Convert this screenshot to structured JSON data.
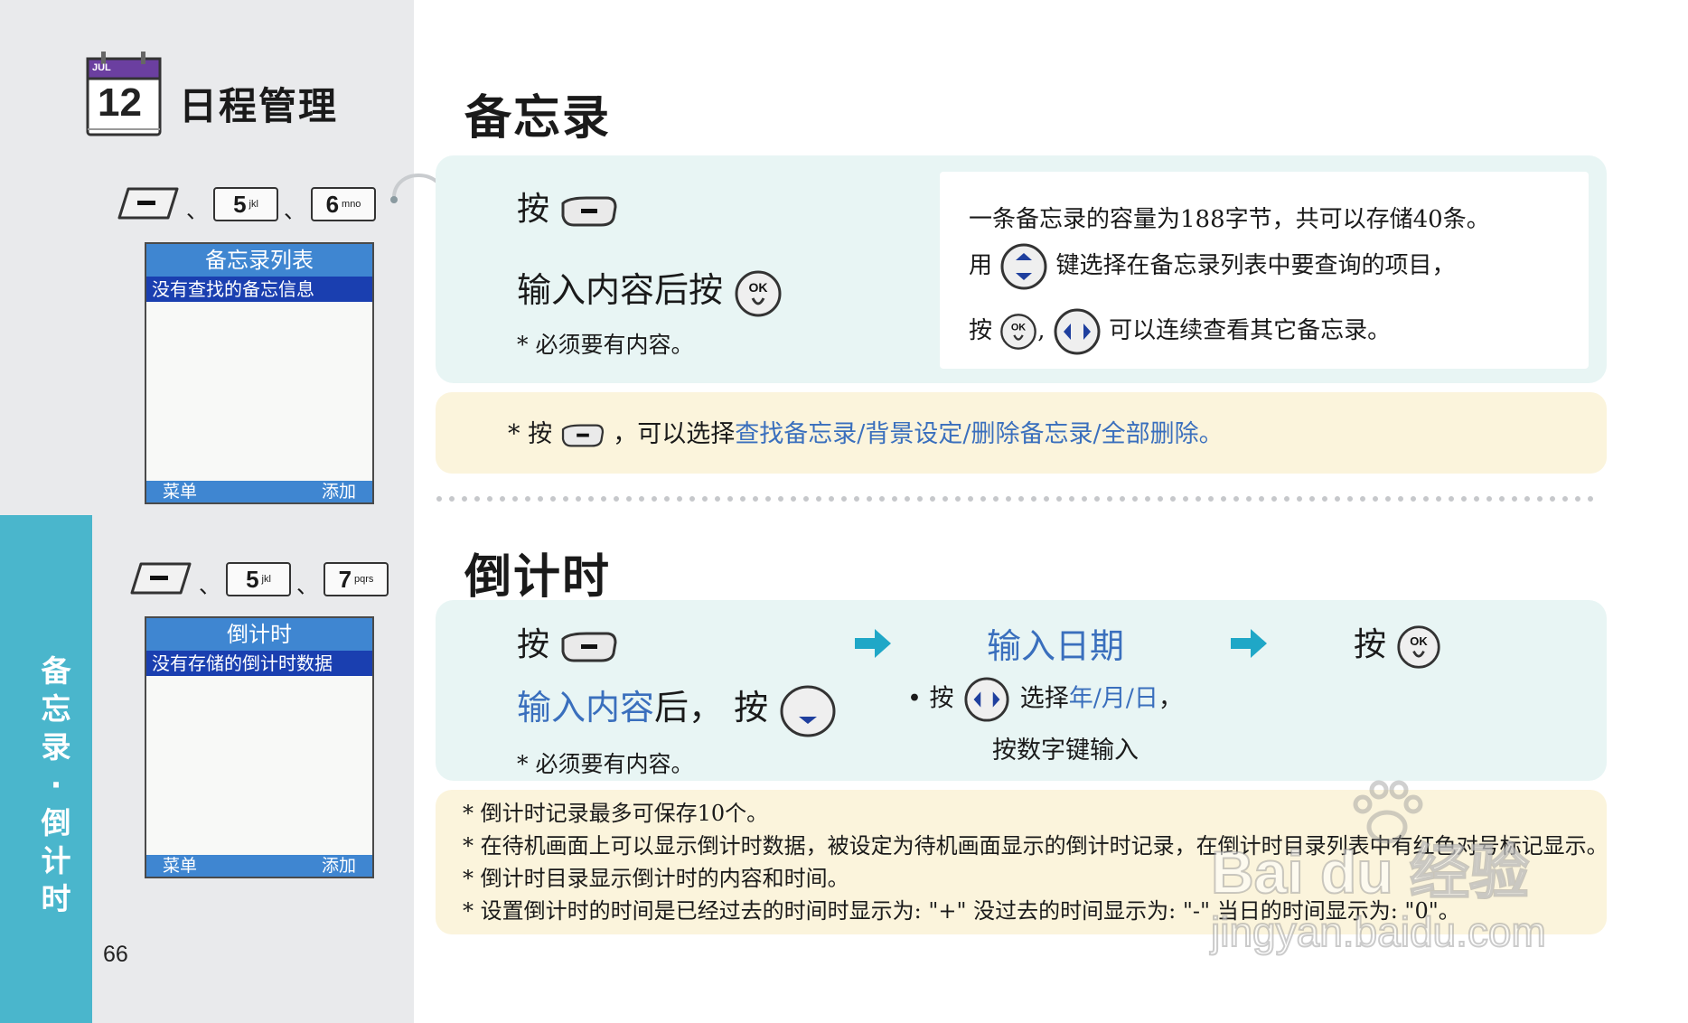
{
  "chapter": {
    "calendar_month": "JUL",
    "calendar_day": "12",
    "title": "日程管理"
  },
  "side_title_chars": [
    "备",
    "忘",
    "录",
    "·",
    "倒",
    "计",
    "时"
  ],
  "page_number": "66",
  "key_separator": "、",
  "memo": {
    "keys": [
      {
        "num": "5",
        "sub": "jkl"
      },
      {
        "num": "6",
        "sub": "mno"
      }
    ],
    "screen": {
      "header": "备忘录列表",
      "row": "没有查找的备忘信息",
      "left_soft": "菜单",
      "right_soft": "添加"
    },
    "heading": "备忘录",
    "step1": "按",
    "step2": "输入内容后按",
    "footnote": "* 必须要有内容。",
    "info_line1": "一条备忘录的容量为188字节，共可以存储40条。",
    "info_line2_pre": "用",
    "info_line2_post": "键选择在备忘录列表中要查询的项目，",
    "info_line3_pre": "按",
    "info_line3_mid": ",",
    "info_line3_post": "可以连续查看其它备忘录。",
    "note_pre": "* 按",
    "note_mid": "，可以选择",
    "note_options": "查找备忘录/背景设定/删除备忘录/全部删除。"
  },
  "countdown": {
    "keys": [
      {
        "num": "5",
        "sub": "jkl"
      },
      {
        "num": "7",
        "sub": "pqrs"
      }
    ],
    "screen": {
      "header": "倒计时",
      "row": "没有存储的倒计时数据",
      "left_soft": "菜单",
      "right_soft": "添加"
    },
    "heading": "倒计时",
    "step1": "按",
    "step2_blue": "输入内容",
    "step2_rest": "后，  按",
    "footnote": "* 必须要有内容。",
    "step3_title": "输入日期",
    "step3_line1_pre": "• 按",
    "step3_line1_post": "选择",
    "step3_line1_blue": "年/月/日",
    "step3_line1_end": "，",
    "step3_line2": "按数字键输入",
    "step4": "按",
    "notes": [
      "* 倒计时记录最多可保存10个。",
      "* 在待机画面上可以显示倒计时数据，被设定为待机画面显示的倒计时记录，在倒计时目录列表中有红色对号标记显示。",
      "* 倒计时目录显示倒计时的内容和时间。",
      "* 设置倒计时的时间是已经过去的时间时显示为: \"+\" 没过去的时间显示为: \"-\"  当日的时间显示为: \"0\"。"
    ]
  },
  "ok_label": "OK",
  "watermark": {
    "line1": "Bai du 经验",
    "line2": "jingyan.baidu.com"
  },
  "colors": {
    "accent_teal": "#4ab6cc",
    "link_blue": "#3a6fbd",
    "panel_teal": "#e8f5f4",
    "note_yellow": "#fbf4dc",
    "arrow": "#1fa7c7"
  }
}
